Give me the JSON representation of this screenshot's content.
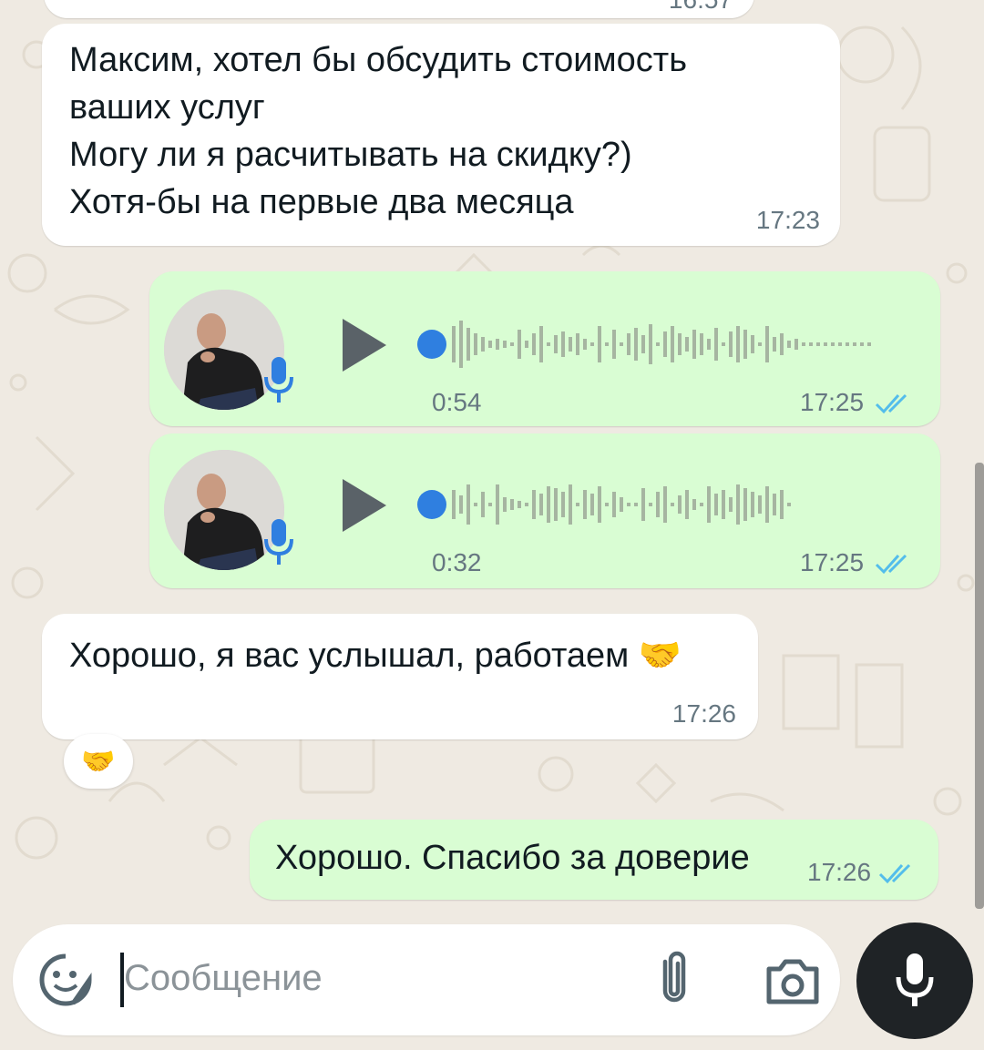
{
  "chat": {
    "top_partial_time": "16:57",
    "messages": [
      {
        "type": "incoming_text",
        "text": "Максим, хотел бы обсудить стоимость\nваших услуг\nМогу ли я расчитывать на скидку?)\nХотя-бы на первые два месяца",
        "time": "17:23"
      },
      {
        "type": "outgoing_voice",
        "duration": "0:54",
        "time": "17:25",
        "status_icon": "double-check-icon"
      },
      {
        "type": "outgoing_voice",
        "duration": "0:32",
        "time": "17:25",
        "status_icon": "double-check-icon"
      },
      {
        "type": "incoming_text",
        "text": "Хорошо, я вас услышал, работаем 🤝",
        "time": "17:26",
        "reaction": "🤝"
      },
      {
        "type": "outgoing_text",
        "text": "Хорошо. Спасибо за доверие",
        "time": "17:26",
        "status_icon": "double-check-icon"
      }
    ]
  },
  "composer": {
    "placeholder": "Сообщение",
    "icons": [
      "sticker-icon",
      "paperclip-icon",
      "camera-icon",
      "microphone-icon"
    ]
  },
  "colors": {
    "background": "#efeae2",
    "incoming_bubble": "#ffffff",
    "outgoing_bubble": "#d9fdd3",
    "read_ticks": "#53bdeb",
    "voice_dot": "#2f7fe0",
    "send_button": "#1f2326"
  }
}
